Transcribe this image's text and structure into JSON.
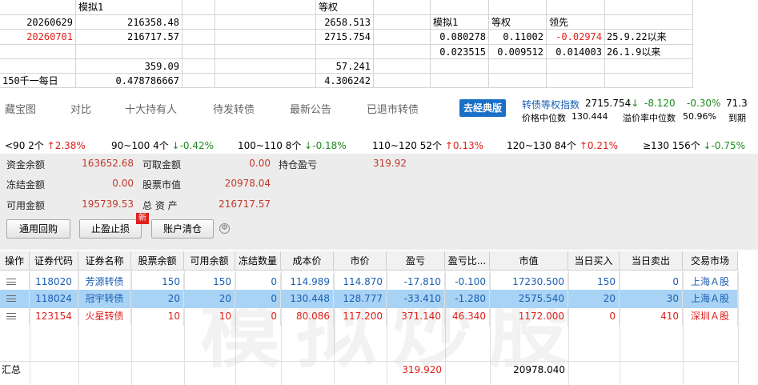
{
  "sheet": {
    "r1": {
      "c2": "模拟1",
      "c5": "等权"
    },
    "r2": {
      "date": "20260629",
      "v1": "216358.48",
      "v2": "2658.513",
      "h1": "模拟1",
      "h2": "等权",
      "h3": "领先"
    },
    "r3": {
      "date": "20260701",
      "v1": "216717.57",
      "v2": "2715.754",
      "a": "0.080278",
      "b": "0.11002",
      "c": "-0.02974",
      "d": "25.9.22以来"
    },
    "r4": {
      "a": "0.023515",
      "b": "0.009512",
      "c": "0.014003",
      "d": "26.1.9以来"
    },
    "r5": {
      "v1": "359.09",
      "v2": "57.241"
    },
    "r6": {
      "label": "150千一每日",
      "v1": "0.478786667",
      "v2": "4.306242"
    }
  },
  "tabs": [
    "藏宝图",
    "对比",
    "十大持有人",
    "待发转债",
    "最新公告",
    "已退市转债"
  ],
  "classic_button": "去经典版",
  "index": {
    "label": "转债等权指数",
    "value": "2715.754",
    "arrow": "↓",
    "change": "-8.120",
    "pct": "-0.30%",
    "extra": "71.3",
    "median_price_label": "价格中位数",
    "median_price": "130.444",
    "median_premium_label": "溢价率中位数",
    "median_premium": "50.96%",
    "extra2": "到期"
  },
  "ranges": [
    {
      "label": "<90",
      "count": "2个",
      "arrow": "↑",
      "pct": "2.38%",
      "dir": "up"
    },
    {
      "label": "90~100",
      "count": "4个",
      "arrow": "↓",
      "pct": "-0.42%",
      "dir": "down"
    },
    {
      "label": "100~110",
      "count": "8个",
      "arrow": "↓",
      "pct": "-0.18%",
      "dir": "down"
    },
    {
      "label": "110~120",
      "count": "52个",
      "arrow": "↑",
      "pct": "0.13%",
      "dir": "up"
    },
    {
      "label": "120~130",
      "count": "84个",
      "arrow": "↑",
      "pct": "0.21%",
      "dir": "up"
    },
    {
      "label": "≥130",
      "count": "156个",
      "arrow": "↓",
      "pct": "-0.75%",
      "dir": "down"
    }
  ],
  "account": {
    "balance_label": "资金余额",
    "balance": "163652.68",
    "withdrawable_label": "可取金额",
    "withdrawable": "0.00",
    "pnl_label": "持仓盈亏",
    "pnl": "319.92",
    "frozen_label": "冻结金额",
    "frozen": "0.00",
    "stock_value_label": "股票市值",
    "stock_value": "20978.04",
    "available_label": "可用金额",
    "available": "195739.53",
    "total_label": "总 资 产",
    "total": "216717.57"
  },
  "buttons": {
    "repo": "通用回购",
    "stop": "止盈止损",
    "clear": "账户清仓",
    "new_badge": "新"
  },
  "table": {
    "headers": [
      "操作",
      "证券代码",
      "证券名称",
      "股票余额",
      "可用余额",
      "冻结数量",
      "成本价",
      "市价",
      "盈亏",
      "盈亏比...",
      "市值",
      "当日买入",
      "当日卖出",
      "交易市场"
    ],
    "rows": [
      {
        "code": "118020",
        "name": "芳源转债",
        "bal": "150",
        "avail": "150",
        "frozen": "0",
        "cost": "114.989",
        "price": "114.870",
        "pnl": "-17.810",
        "pnlpct": "-0.100",
        "value": "17230.500",
        "buy": "150",
        "sell": "0",
        "market": "上海Ａ股"
      },
      {
        "code": "118024",
        "name": "冠宇转债",
        "bal": "20",
        "avail": "20",
        "frozen": "0",
        "cost": "130.448",
        "price": "128.777",
        "pnl": "-33.410",
        "pnlpct": "-1.280",
        "value": "2575.540",
        "buy": "20",
        "sell": "30",
        "market": "上海Ａ股"
      },
      {
        "code": "123154",
        "name": "火星转债",
        "bal": "10",
        "avail": "10",
        "frozen": "0",
        "cost": "80.086",
        "price": "117.200",
        "pnl": "371.140",
        "pnlpct": "46.340",
        "value": "1172.000",
        "buy": "0",
        "sell": "410",
        "market": "深圳Ａ股"
      }
    ],
    "total_label": "汇总",
    "total_pnl": "319.920",
    "total_value": "20978.040"
  },
  "watermark": "模拟炒股"
}
